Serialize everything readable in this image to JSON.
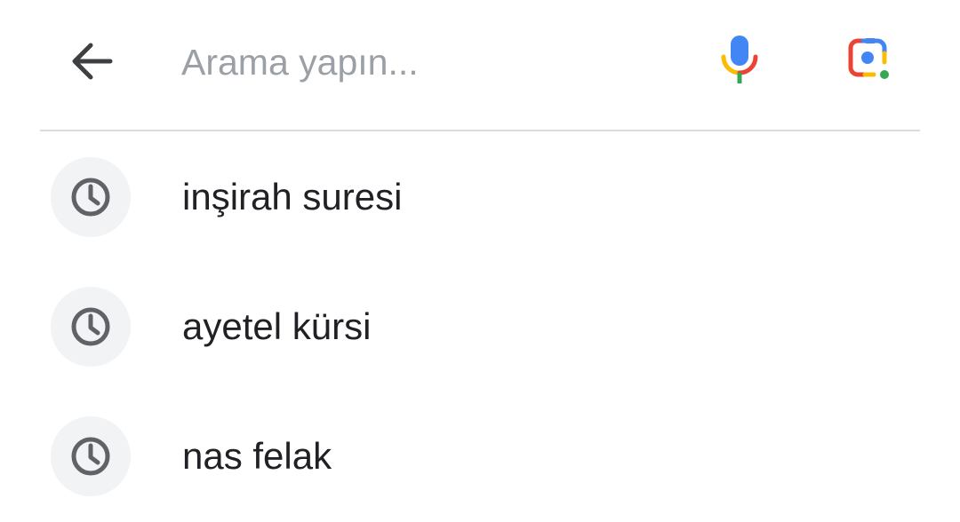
{
  "search": {
    "placeholder": "Arama yapın...",
    "value": "",
    "back_icon": "arrow-left-icon",
    "mic_icon": "microphone-icon",
    "lens_icon": "google-lens-icon"
  },
  "suggestions": [
    {
      "text": "inşirah suresi",
      "icon": "history-clock-icon"
    },
    {
      "text": "ayetel kürsi",
      "icon": "history-clock-icon"
    },
    {
      "text": "nas felak",
      "icon": "history-clock-icon"
    }
  ],
  "colors": {
    "google_blue": "#4285F4",
    "google_red": "#EA4335",
    "google_yellow": "#FBBC04",
    "google_green": "#34A853",
    "text_primary": "#202124",
    "placeholder": "#9aa0a6",
    "icon_gray": "#5f6368",
    "bubble_bg": "#f1f3f4",
    "divider": "#dadce0"
  }
}
